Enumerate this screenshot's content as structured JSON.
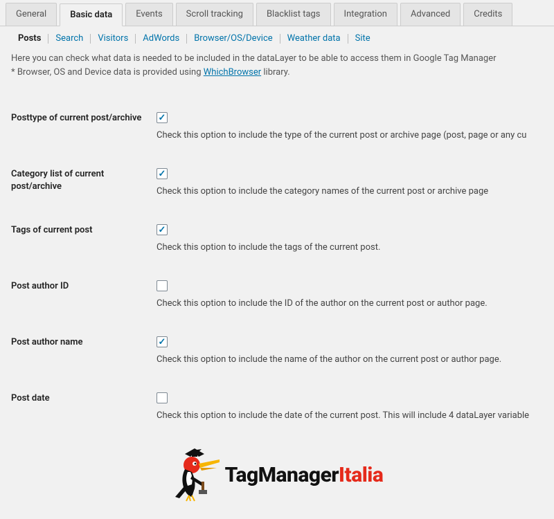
{
  "tabs": {
    "items": [
      "General",
      "Basic data",
      "Events",
      "Scroll tracking",
      "Blacklist tags",
      "Integration",
      "Advanced",
      "Credits"
    ],
    "active_index": 1
  },
  "sub_tabs": {
    "items": [
      "Posts",
      "Search",
      "Visitors",
      "AdWords",
      "Browser/OS/Device",
      "Weather data",
      "Site"
    ],
    "active_index": 0
  },
  "intro": {
    "line1": "Here you can check what data is needed to be included in the dataLayer to be able to access them in Google Tag Manager",
    "line2_prefix": "* Browser, OS and Device data is provided using ",
    "line2_link": "WhichBrowser",
    "line2_suffix": " library."
  },
  "settings": [
    {
      "key": "posttype",
      "label": "Posttype of current post/archive",
      "checked": true,
      "desc": "Check this option to include the type of the current post or archive page (post, page or any cu"
    },
    {
      "key": "categories",
      "label": "Category list of current post/archive",
      "checked": true,
      "desc": "Check this option to include the category names of the current post or archive page"
    },
    {
      "key": "tags",
      "label": "Tags of current post",
      "checked": true,
      "desc": "Check this option to include the tags of the current post."
    },
    {
      "key": "author_id",
      "label": "Post author ID",
      "checked": false,
      "desc": "Check this option to include the ID of the author on the current post or author page."
    },
    {
      "key": "author_name",
      "label": "Post author name",
      "checked": true,
      "desc": "Check this option to include the name of the author on the current post or author page."
    },
    {
      "key": "post_date",
      "label": "Post date",
      "checked": false,
      "desc": "Check this option to include the date of the current post. This will include 4 dataLayer variable"
    }
  ],
  "logo": {
    "text_a": "TagManager",
    "text_b": "Italia"
  }
}
